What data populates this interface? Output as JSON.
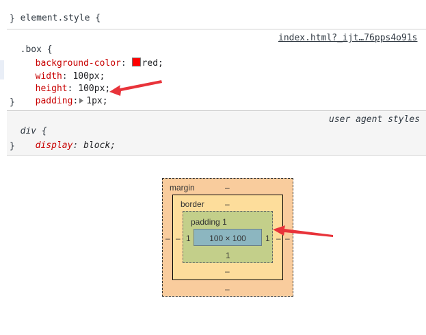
{
  "rules": {
    "element_style": {
      "selector": "element.style",
      "open": "{",
      "close": "}"
    },
    "box": {
      "selector": ".box",
      "open": "{",
      "close": "}",
      "source": "index.html?_ijt…76pps4o91s",
      "decls": [
        {
          "prop": "background-color",
          "value": "red;",
          "swatch": "#ff0000"
        },
        {
          "prop": "width",
          "value": "100px;"
        },
        {
          "prop": "height",
          "value": "100px;"
        },
        {
          "prop": "padding",
          "value": "1px;"
        }
      ]
    },
    "div": {
      "selector": "div",
      "open": "{",
      "close": "}",
      "source": "user agent styles",
      "decls": [
        {
          "prop": "display",
          "value": "block;"
        }
      ]
    }
  },
  "box_model": {
    "margin": {
      "label": "margin",
      "top": "–",
      "bottom": "–",
      "left": "–",
      "right": "–"
    },
    "border": {
      "label": "border",
      "top": "–",
      "bottom": "–",
      "left": "–",
      "right": "–"
    },
    "padding": {
      "label": "padding",
      "top": "1",
      "bottom": "1",
      "left": "1",
      "right": "1"
    },
    "content": {
      "size": "100 × 100"
    }
  },
  "colors": {
    "annotation_arrow": "#e8333a",
    "property": "#c80000"
  },
  "icons": [
    "expand-triangle-icon",
    "color-swatch",
    "red-arrow-annotation"
  ]
}
